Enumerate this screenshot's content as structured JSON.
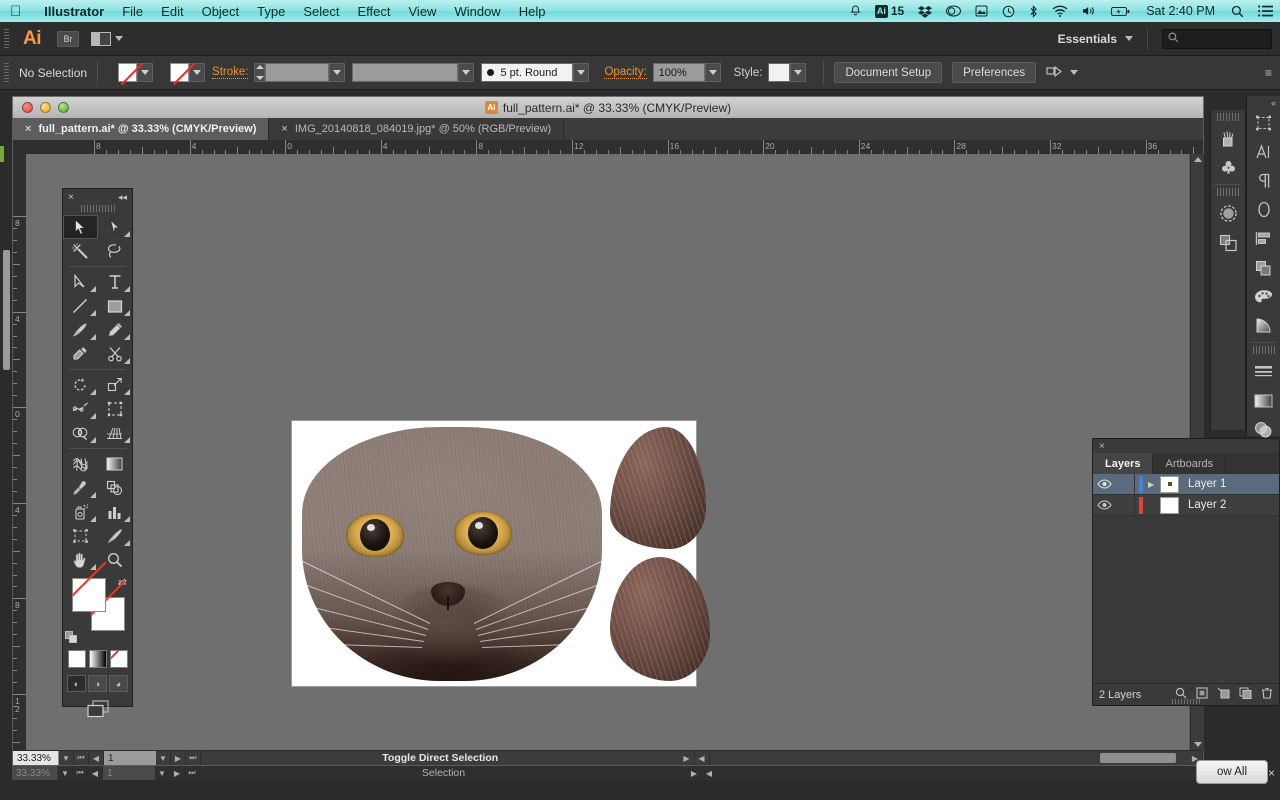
{
  "os_menu": {
    "apple_icon": "apple-icon",
    "items": [
      {
        "label": "Illustrator",
        "bold": true
      },
      {
        "label": "File",
        "bold": false
      },
      {
        "label": "Edit",
        "bold": false
      },
      {
        "label": "Object",
        "bold": false
      },
      {
        "label": "Type",
        "bold": false
      },
      {
        "label": "Select",
        "bold": false
      },
      {
        "label": "Effect",
        "bold": false
      },
      {
        "label": "View",
        "bold": false
      },
      {
        "label": "Window",
        "bold": false
      },
      {
        "label": "Help",
        "bold": false
      }
    ],
    "status_icons": [
      {
        "name": "notification-bell-icon",
        "glyph": "△"
      },
      {
        "name": "illustrator-version-icon",
        "glyph": "Ai"
      },
      {
        "name": "dropbox-icon",
        "glyph": "❖"
      },
      {
        "name": "creative-cloud-icon",
        "glyph": "◎"
      },
      {
        "name": "colorsync-icon",
        "glyph": "▦"
      },
      {
        "name": "time-machine-icon",
        "glyph": "↺"
      },
      {
        "name": "bluetooth-icon",
        "glyph": "✱"
      },
      {
        "name": "wifi-icon",
        "glyph": "◠"
      },
      {
        "name": "volume-icon",
        "glyph": "◂"
      },
      {
        "name": "battery-icon",
        "glyph": "▭"
      }
    ],
    "version_badge": "15",
    "clock": "Sat 2:40 PM",
    "spotlight_icon": "search-icon",
    "notification_center_icon": "list-icon"
  },
  "app_bar": {
    "logo": "Ai",
    "bridge_button": "Br",
    "arrange_documents_label": "arrange-documents",
    "workspace": "Essentials",
    "search_placeholder": ""
  },
  "control_bar": {
    "selection_status": "No Selection",
    "fill_label": "fill-swatch",
    "stroke_label": "Stroke:",
    "stroke_weight": "",
    "stroke_profile": "",
    "brush_definition": "5 pt. Round",
    "opacity_label": "Opacity:",
    "opacity_value": "100%",
    "style_label": "Style:",
    "document_setup_button": "Document Setup",
    "preferences_button": "Preferences"
  },
  "document_window": {
    "title": "full_pattern.ai* @ 33.33% (CMYK/Preview)",
    "title_icon": "Ai",
    "tabs": [
      {
        "label": "full_pattern.ai* @ 33.33% (CMYK/Preview)",
        "active": true,
        "close": "×"
      },
      {
        "label": "IMG_20140818_084019.jpg* @ 50% (RGB/Preview)",
        "active": false,
        "close": "×"
      }
    ],
    "h_ruler_labels": [
      "8",
      "4",
      "0",
      "4",
      "8",
      "12",
      "16",
      "20",
      "24",
      "28",
      "32",
      "36"
    ],
    "v_ruler_labels": [
      "8",
      "4",
      "0",
      "4",
      "8",
      "1\n2"
    ],
    "artwork": {
      "description": "cat-face-artwork",
      "pieces": [
        "cat-face-shape",
        "cat-ear-top-shape",
        "cat-ear-bottom-shape"
      ]
    }
  },
  "doc_status_bar": {
    "zoom_level": "33.33%",
    "page_number": "1",
    "status_message": "Toggle Direct Selection",
    "status_message_secondary": "Selection"
  },
  "toolbox": {
    "close_icon": "×",
    "collapse_icon": "◂◂",
    "tools": [
      {
        "name": "selection-tool",
        "active": true,
        "has_flyout": false
      },
      {
        "name": "direct-selection-tool",
        "active": false,
        "has_flyout": true
      },
      {
        "name": "magic-wand-tool",
        "active": false,
        "has_flyout": false
      },
      {
        "name": "lasso-tool",
        "active": false,
        "has_flyout": false
      },
      {
        "name": "pen-tool",
        "active": false,
        "has_flyout": true
      },
      {
        "name": "type-tool",
        "active": false,
        "has_flyout": true
      },
      {
        "name": "line-segment-tool",
        "active": false,
        "has_flyout": true
      },
      {
        "name": "rectangle-tool",
        "active": false,
        "has_flyout": true
      },
      {
        "name": "paintbrush-tool",
        "active": false,
        "has_flyout": true
      },
      {
        "name": "pencil-tool",
        "active": false,
        "has_flyout": true
      },
      {
        "name": "blob-brush-tool",
        "active": false,
        "has_flyout": false
      },
      {
        "name": "eraser-scissors-tool",
        "active": false,
        "has_flyout": true
      },
      {
        "name": "rotate-tool",
        "active": false,
        "has_flyout": true
      },
      {
        "name": "scale-tool",
        "active": false,
        "has_flyout": true
      },
      {
        "name": "width-warp-tool",
        "active": false,
        "has_flyout": true
      },
      {
        "name": "free-transform-tool",
        "active": false,
        "has_flyout": false
      },
      {
        "name": "shape-builder-tool",
        "active": false,
        "has_flyout": true
      },
      {
        "name": "perspective-grid-tool",
        "active": false,
        "has_flyout": true
      },
      {
        "name": "mesh-tool",
        "active": false,
        "has_flyout": false
      },
      {
        "name": "gradient-tool",
        "active": false,
        "has_flyout": false
      },
      {
        "name": "eyedropper-tool",
        "active": false,
        "has_flyout": true
      },
      {
        "name": "blend-tool",
        "active": false,
        "has_flyout": false
      },
      {
        "name": "symbol-sprayer-tool",
        "active": false,
        "has_flyout": true
      },
      {
        "name": "column-graph-tool",
        "active": false,
        "has_flyout": true
      },
      {
        "name": "artboard-tool",
        "active": false,
        "has_flyout": false
      },
      {
        "name": "slice-tool",
        "active": false,
        "has_flyout": true
      },
      {
        "name": "hand-tool",
        "active": false,
        "has_flyout": true
      },
      {
        "name": "zoom-tool",
        "active": false,
        "has_flyout": false
      }
    ],
    "fill_swatch": "none",
    "stroke_swatch": "none",
    "color_mode_buttons": [
      "color-mode",
      "gradient-mode",
      "none-mode"
    ],
    "drawing_modes": [
      "draw-normal",
      "draw-behind",
      "draw-inside"
    ],
    "screen_mode": "change-screen-mode"
  },
  "right_dock": {
    "outer_buttons": [
      {
        "name": "artboards-panel-icon",
        "glyph": "⬚"
      },
      {
        "name": "character-panel-icon",
        "glyph": "A"
      },
      {
        "name": "paragraph-panel-icon",
        "glyph": "¶"
      },
      {
        "name": "glyphs-panel-icon",
        "glyph": "O"
      },
      {
        "name": "align-panel-icon",
        "glyph": "≡"
      },
      {
        "name": "pathfinder-panel-icon",
        "glyph": "⧉"
      },
      {
        "name": "color-panel-icon",
        "glyph": "◑"
      },
      {
        "name": "color-guide-panel-icon",
        "glyph": "◥"
      },
      {
        "name": "stroke-panel-icon",
        "glyph": "☰"
      },
      {
        "name": "gradient-panel-icon",
        "glyph": "▤"
      },
      {
        "name": "transparency-panel-icon",
        "glyph": "◍"
      }
    ],
    "inner_buttons": [
      {
        "name": "brushes-panel-icon",
        "glyph": "✇"
      },
      {
        "name": "symbols-panel-icon",
        "glyph": "♣"
      },
      {
        "name": "appearance-panel-icon",
        "glyph": "◌"
      },
      {
        "name": "layers-panel-icon",
        "glyph": "⧉"
      }
    ],
    "collapse_icon": "«"
  },
  "layers_panel": {
    "close_icon": "×",
    "tabs": [
      {
        "label": "Layers",
        "active": true
      },
      {
        "label": "Artboards",
        "active": false
      }
    ],
    "rows": [
      {
        "name": "Layer 1",
        "selected": true,
        "visible": true,
        "color": "#4a7fd4",
        "expandable": true,
        "thumb_has_art": true
      },
      {
        "name": "Layer 2",
        "selected": false,
        "visible": true,
        "color": "#e0453c",
        "expandable": false,
        "thumb_has_art": false
      }
    ],
    "footer_count": "2 Layers",
    "footer_icons": [
      {
        "name": "locate-object-icon",
        "glyph": "⌕"
      },
      {
        "name": "make-clipping-mask-icon",
        "glyph": "◰"
      },
      {
        "name": "create-new-sublayer-icon",
        "glyph": "⬒"
      },
      {
        "name": "create-new-layer-icon",
        "glyph": "⬚"
      },
      {
        "name": "delete-selection-icon",
        "glyph": "⌦"
      }
    ]
  },
  "show_all_button": {
    "label": "ow All",
    "close_icon": "×"
  }
}
